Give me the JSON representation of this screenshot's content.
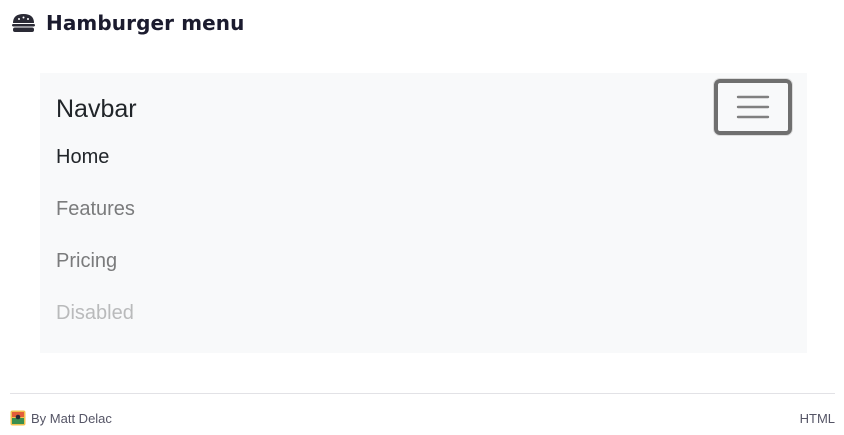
{
  "header": {
    "icon": "hamburger-icon",
    "title": "Hamburger menu"
  },
  "navbar": {
    "brand": "Navbar",
    "toggler_icon": "menu-icon",
    "items": [
      {
        "label": "Home",
        "state": "active"
      },
      {
        "label": "Features",
        "state": "normal"
      },
      {
        "label": "Pricing",
        "state": "normal"
      },
      {
        "label": "Disabled",
        "state": "disabled"
      }
    ],
    "colors": {
      "background": "#f8f9fa",
      "active": "#212529",
      "normal": "#7a7b7c",
      "disabled": "#b9babb",
      "toggler_border": "#6f6f6f"
    }
  },
  "footer": {
    "author_icon": "author-avatar-icon",
    "author": "By Matt Delac",
    "language": "HTML"
  }
}
